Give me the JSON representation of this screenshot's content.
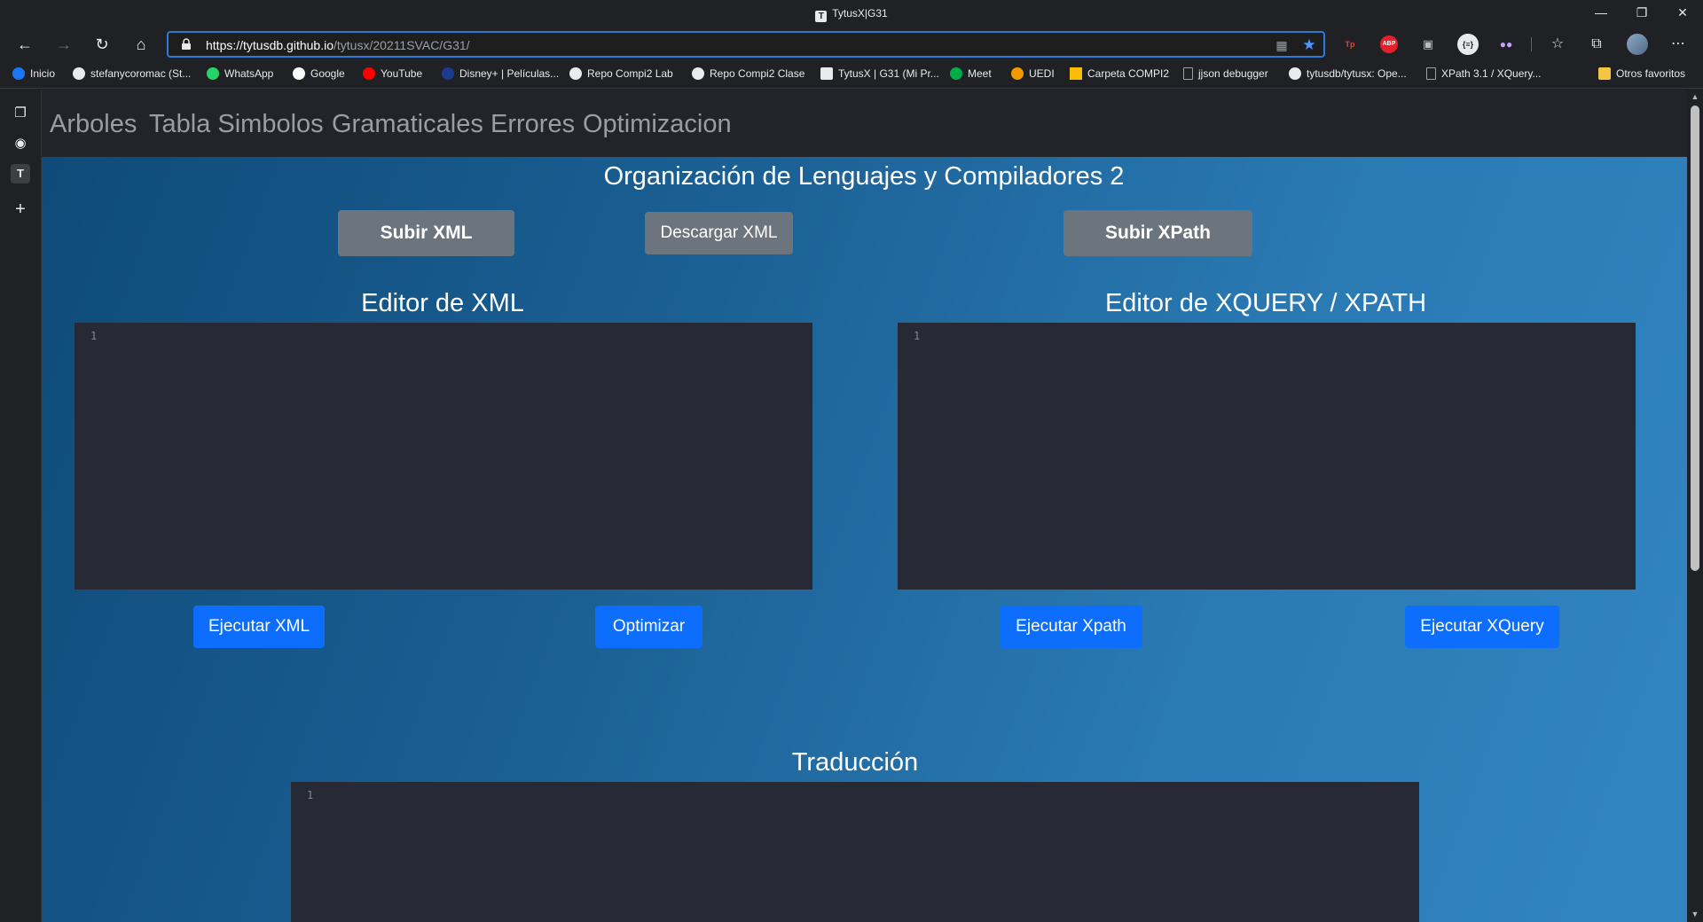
{
  "window": {
    "title": "TytusX|G31",
    "controls": [
      "minimize-icon",
      "restore-icon",
      "close-icon"
    ]
  },
  "toolbar": {
    "url_host": "https://tytusdb.github.io",
    "url_path": "/tytusx/20211SVAC/G31/",
    "icons": [
      "back-icon",
      "forward-icon",
      "refresh-icon",
      "home-icon",
      "lock-icon",
      "grid-icon",
      "star-icon",
      "favorites-icon",
      "collections-icon",
      "profile-avatar",
      "more-icon"
    ],
    "extensions": [
      {
        "label": "Tp",
        "color": "#e0443a",
        "name": "tp-extension-icon"
      },
      {
        "label": "ABP",
        "color": "#e5202b",
        "name": "adblock-extension-icon"
      },
      {
        "label": "▣",
        "color": "#555555",
        "name": "screenshot-extension-icon"
      },
      {
        "label": "{≡}",
        "color": "#e8eaed",
        "name": "json-extension-icon"
      },
      {
        "label": "👓",
        "color": "#6a4fb0",
        "name": "glasses-extension-icon"
      }
    ]
  },
  "bookmarks": [
    {
      "label": "Inicio",
      "color": "#1877f2"
    },
    {
      "label": "stefanycoromac (St...",
      "color": "#e8eaed"
    },
    {
      "label": "WhatsApp",
      "color": "#25d366"
    },
    {
      "label": "Google",
      "color": "#ffffff"
    },
    {
      "label": "YouTube",
      "color": "#ff0000"
    },
    {
      "label": "Disney+ | Películas...",
      "color": "#1b3b8f"
    },
    {
      "label": "Repo Compi2 Lab",
      "color": "#e8eaed"
    },
    {
      "label": "Repo Compi2 Clase",
      "color": "#e8eaed"
    },
    {
      "label": "TytusX | G31 (Mi Pr...",
      "color": "#e8eaed"
    },
    {
      "label": "Meet",
      "color": "#00ac47"
    },
    {
      "label": "UEDI",
      "color": "#f29900"
    },
    {
      "label": "Carpeta COMPI2",
      "color": "#fbbc04"
    },
    {
      "label": "jjson debugger",
      "color": "#9aa0a6"
    },
    {
      "label": "tytusdb/tytusx: Ope...",
      "color": "#e8eaed"
    },
    {
      "label": "XPath 3.1 / XQuery...",
      "color": "#9aa0a6"
    }
  ],
  "other_favorites": "Otros favoritos",
  "nav": {
    "links": [
      "Arboles",
      "Tabla Simbolos",
      "Gramaticales",
      "Errores",
      "Optimizacion"
    ]
  },
  "main": {
    "title": "Organización de Lenguajes y Compiladores 2",
    "upload_xml": "Subir XML",
    "download_xml": "Descargar XML",
    "upload_xpath": "Subir XPath",
    "xml_editor_title": "Editor de XML",
    "xquery_editor_title": "Editor de XQUERY / XPATH",
    "line_number": "1",
    "run_xml": "Ejecutar XML",
    "optimize": "Optimizar",
    "run_xpath": "Ejecutar Xpath",
    "run_xquery": "Ejecutar XQuery",
    "translation_title": "Traducción"
  }
}
